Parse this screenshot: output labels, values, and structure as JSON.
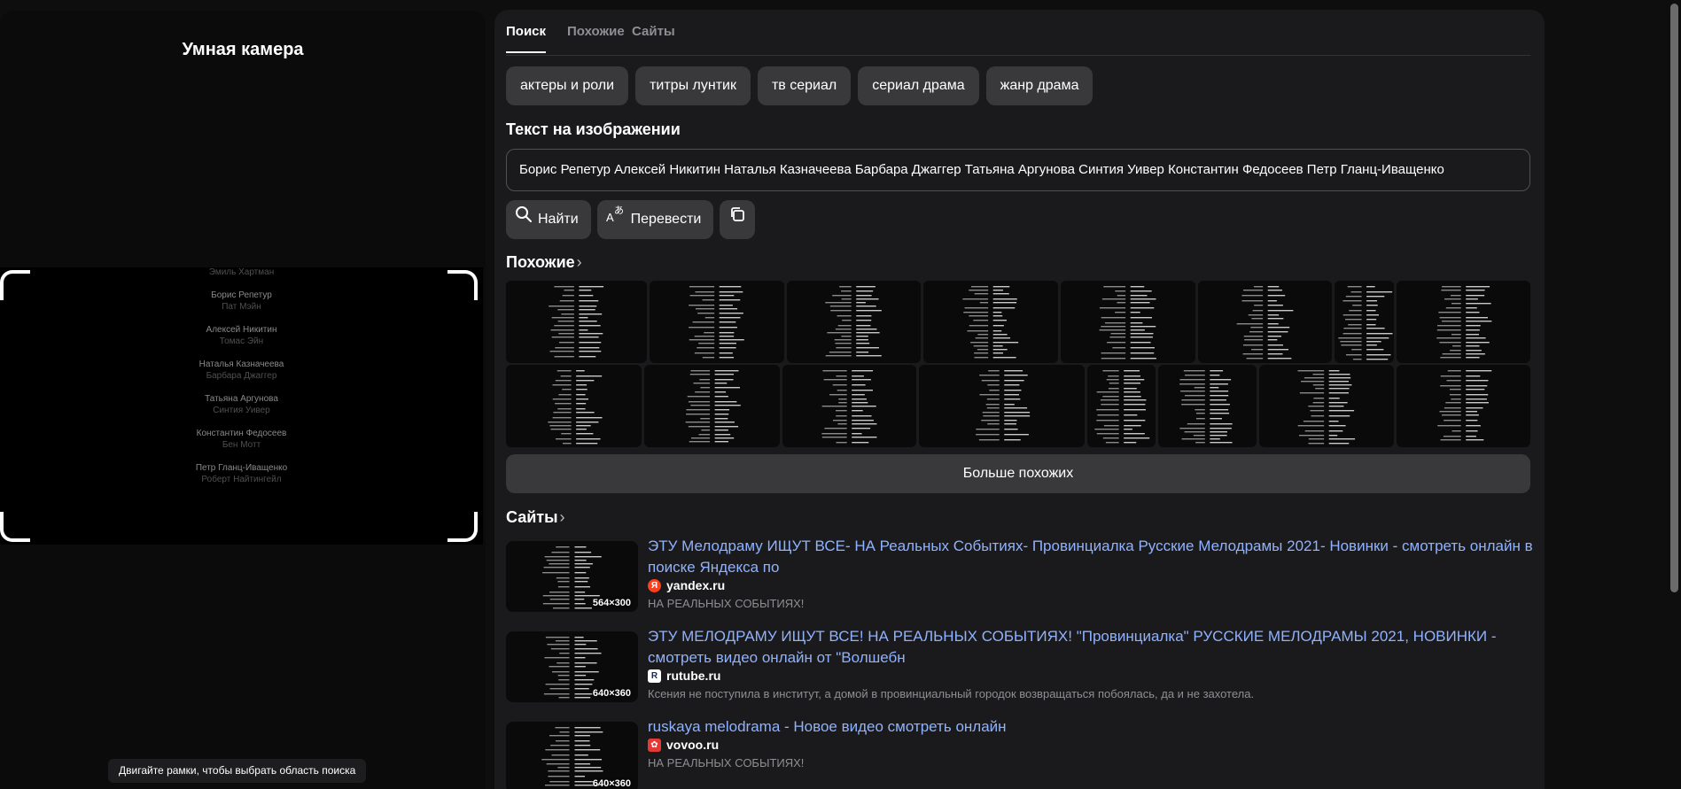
{
  "left_panel": {
    "title": "Умная камера",
    "hint": "Двигайте рамки, чтобы выбрать область поиска",
    "preview_credits": [
      {
        "actor": "",
        "role": "Эмиль Хартман"
      },
      {
        "actor": "Борис Репетур",
        "role": "Пат Мэйн"
      },
      {
        "actor": "Алексей Никитин",
        "role": "Томас Эйн"
      },
      {
        "actor": "Наталья Казначеева",
        "role": "Барбара Джаггер"
      },
      {
        "actor": "Татьяна Аргунова",
        "role": "Синтия Уивер"
      },
      {
        "actor": "Константин Федосеев",
        "role": "Бен Мотт"
      },
      {
        "actor": "Петр Гланц-Иващенко",
        "role": "Роберт Найтингейл"
      }
    ]
  },
  "tabs": [
    {
      "label": "Поиск",
      "active": true
    },
    {
      "label": "Похожие",
      "active": false
    },
    {
      "label": "Сайты",
      "active": false
    }
  ],
  "chips": [
    "актеры и роли",
    "титры лунтик",
    "тв сериал",
    "сериал драма",
    "жанр драма"
  ],
  "text_section": {
    "title": "Текст на изображении",
    "value": "Борис Репетур Алексей Никитин Наталья Казначеева Барбара Джаггер Татьяна Аргунова Синтия Уивер Константин Федосеев Петр Гланц-Иващенко"
  },
  "actions": {
    "find_label": "Найти",
    "translate_label": "Перевести"
  },
  "similar": {
    "title": "Похожие",
    "chevron": "›",
    "more_label": "Больше похожих"
  },
  "sites": {
    "title": "Сайты",
    "chevron": "›",
    "items": [
      {
        "title": "ЭТУ Мелодраму ИЩУТ ВСЕ- НА Реальных Событиях- Провинциалка Русские Мелодрамы 2021- Новинки - смотреть онлайн в поиске Яндекса по",
        "domain": "yandex.ru",
        "favicon": "Я",
        "description": "НА РЕАЛЬНЫХ СОБЫТИЯХ!",
        "size": "564×300"
      },
      {
        "title": "ЭТУ МЕЛОДРАМУ ИЩУТ ВСЕ! НА РЕАЛЬНЫХ СОБЫТИЯХ! \"Провинциалка\" РУССКИЕ МЕЛОДРАМЫ 2021, НОВИНКИ - смотреть видео онлайн от \"Волшебн",
        "domain": "rutube.ru",
        "favicon": "R",
        "description": "Ксения не поступила в институт, а домой в провинциальный городок возвращаться побоялась, да и не захотела.",
        "size": "640×360"
      },
      {
        "title": "ruskaya melodrama - Новое видео смотреть онлайн",
        "domain": "vovoo.ru",
        "favicon": "✿",
        "description": "НА РЕАЛЬНЫХ СОБЫТИЯХ!",
        "size": "640×360"
      }
    ]
  },
  "colors": {
    "link": "#8fb2ff",
    "panel": "#1a1a1c",
    "chip": "#39393b",
    "yandex_favicon": "#fc3f1d"
  }
}
